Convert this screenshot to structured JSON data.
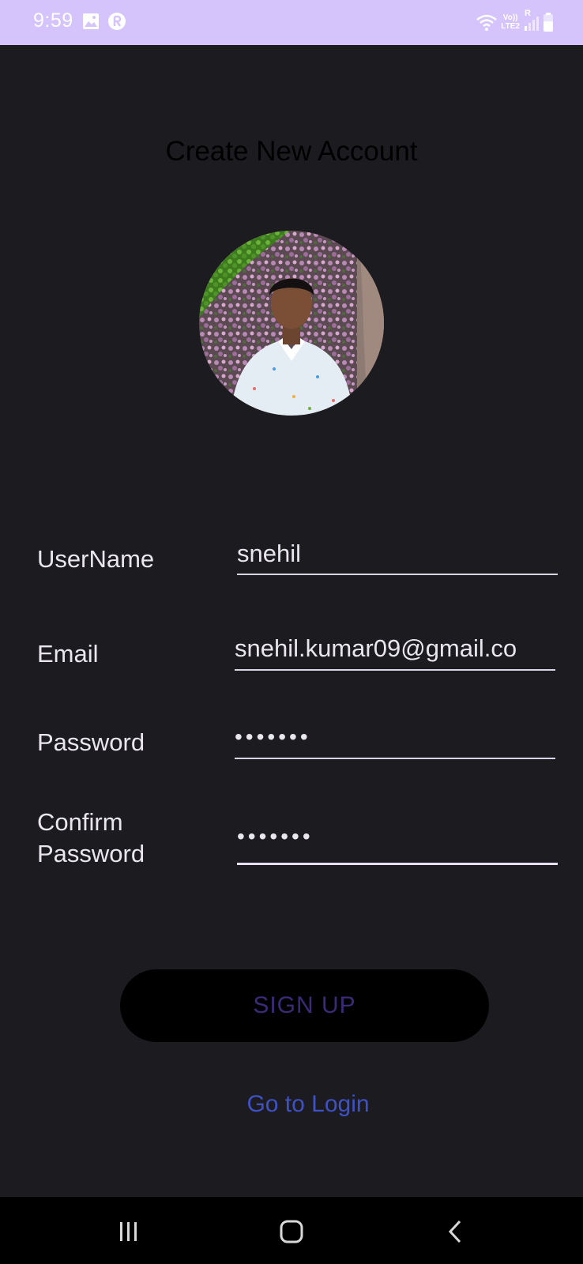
{
  "status_bar": {
    "time": "9:59",
    "icons": [
      "gallery-icon",
      "r-app-icon",
      "wifi-icon",
      "volte-lte2-icon",
      "signal-icon",
      "battery-icon"
    ],
    "volte_text": "Vo))",
    "lte_text": "LTE2",
    "r_text": "R"
  },
  "page": {
    "title": "Create New Account"
  },
  "form": {
    "username": {
      "label": "UserName",
      "value": "snehil"
    },
    "email": {
      "label": "Email",
      "value": "snehil.kumar09@gmail.co"
    },
    "password": {
      "label": "Password",
      "value": "•••••••"
    },
    "confirm_password": {
      "label_line1": "Confirm",
      "label_line2": "Password",
      "value": "•••••••"
    }
  },
  "actions": {
    "signup_label": "SIGN UP",
    "login_link": "Go to Login"
  },
  "navigation": {
    "buttons": [
      "recent-apps-icon",
      "home-icon",
      "back-icon"
    ]
  },
  "colors": {
    "status_bar": "#d4c4fb",
    "background": "#1c1b20",
    "button_bg": "#000000",
    "button_text": "#3b2a78",
    "link": "#3f51c6"
  }
}
